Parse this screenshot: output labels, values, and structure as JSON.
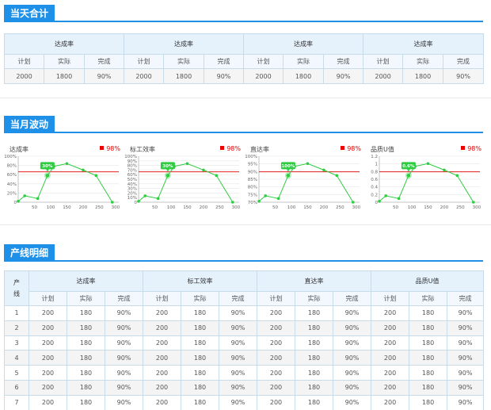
{
  "sections": {
    "summary_title": "当天合计",
    "fluctuation_title": "当月波动",
    "detail_title": "产线明细"
  },
  "metric_groups": [
    "达成率",
    "达成率",
    "达成率",
    "达成率"
  ],
  "sub_headers": [
    "计划",
    "实际",
    "完成"
  ],
  "summary_values": [
    [
      "2000",
      "1800",
      "90%"
    ],
    [
      "2000",
      "1800",
      "90%"
    ],
    [
      "2000",
      "1800",
      "90%"
    ],
    [
      "2000",
      "1800",
      "90%"
    ]
  ],
  "chart_data": [
    {
      "type": "line",
      "title": "达成率",
      "goal_label": "98%",
      "x": [
        0,
        20,
        60,
        90,
        110,
        150,
        200,
        240,
        290
      ],
      "y": [
        0.02,
        0.14,
        0.08,
        0.58,
        0.78,
        0.84,
        0.7,
        0.58,
        0.0
      ],
      "x_ticks": [
        "50",
        "100",
        "150",
        "200",
        "250",
        "300"
      ],
      "x_tick_values": [
        50,
        100,
        150,
        200,
        250,
        300
      ],
      "y_ticks": [
        "0",
        "20%",
        "40%",
        "60%",
        "80%",
        "100%"
      ],
      "y_tick_values": [
        0,
        0.2,
        0.4,
        0.6,
        0.8,
        1.0
      ],
      "ylim": [
        0,
        1.0
      ],
      "xlim": [
        0,
        310
      ],
      "goal_value": 0.66,
      "highlight_index": 3,
      "highlight_label": "30%",
      "line_color": "#2ecc40",
      "goal_color": "#e00000"
    },
    {
      "type": "line",
      "title": "标工效率",
      "goal_label": "98%",
      "x": [
        0,
        20,
        60,
        90,
        110,
        150,
        200,
        240,
        290
      ],
      "y": [
        0.02,
        0.14,
        0.08,
        0.58,
        0.78,
        0.84,
        0.7,
        0.58,
        0.0
      ],
      "x_ticks": [
        "50",
        "100",
        "150",
        "200",
        "250",
        "300"
      ],
      "x_tick_values": [
        50,
        100,
        150,
        200,
        250,
        300
      ],
      "y_ticks": [
        "0",
        "10%",
        "20%",
        "30%",
        "40%",
        "50%",
        "60%",
        "70%",
        "80%",
        "90%",
        "100%"
      ],
      "y_tick_values": [
        0,
        0.1,
        0.2,
        0.3,
        0.4,
        0.5,
        0.6,
        0.7,
        0.8,
        0.9,
        1.0
      ],
      "ylim": [
        0,
        1.0
      ],
      "xlim": [
        0,
        310
      ],
      "goal_value": 0.66,
      "highlight_index": 3,
      "highlight_label": "30%",
      "line_color": "#2ecc40",
      "goal_color": "#e00000"
    },
    {
      "type": "line",
      "title": "直达率",
      "goal_label": "98%",
      "x": [
        0,
        20,
        60,
        90,
        110,
        150,
        200,
        240,
        290
      ],
      "y": [
        0.02,
        0.14,
        0.08,
        0.58,
        0.78,
        0.84,
        0.7,
        0.58,
        0.0
      ],
      "x_ticks": [
        "50",
        "100",
        "150",
        "200",
        "250",
        "300"
      ],
      "x_tick_values": [
        50,
        100,
        150,
        200,
        250,
        300
      ],
      "y_ticks": [
        "70%",
        "75%",
        "80%",
        "85%",
        "90%",
        "95%",
        "100%"
      ],
      "y_tick_values": [
        0,
        0.1667,
        0.3333,
        0.5,
        0.6667,
        0.8333,
        1.0
      ],
      "ylim": [
        0,
        1.0
      ],
      "xlim": [
        0,
        310
      ],
      "goal_value": 0.66,
      "highlight_index": 3,
      "highlight_label": "100%",
      "line_color": "#2ecc40",
      "goal_color": "#e00000"
    },
    {
      "type": "line",
      "title": "品质U值",
      "goal_label": "98%",
      "x": [
        0,
        20,
        60,
        90,
        110,
        150,
        200,
        240,
        290
      ],
      "y": [
        0.02,
        0.14,
        0.08,
        0.58,
        0.78,
        0.84,
        0.7,
        0.58,
        0.0
      ],
      "x_ticks": [
        "50",
        "100",
        "150",
        "200",
        "250",
        "300"
      ],
      "x_tick_values": [
        50,
        100,
        150,
        200,
        250,
        300
      ],
      "y_ticks": [
        "0",
        "0.2",
        "0.4",
        "0.6",
        "0.8",
        "1",
        "1.2"
      ],
      "y_tick_values": [
        0,
        0.1667,
        0.3333,
        0.5,
        0.6667,
        0.8333,
        1.0
      ],
      "ylim": [
        0,
        1.0
      ],
      "xlim": [
        0,
        310
      ],
      "goal_value": 0.66,
      "highlight_index": 3,
      "highlight_label": "0.6%",
      "line_color": "#2ecc40",
      "goal_color": "#e00000"
    }
  ],
  "detail": {
    "row_header": "产线",
    "groups": [
      "达成率",
      "标工效率",
      "直达率",
      "品质U值"
    ],
    "rows": [
      {
        "no": "1",
        "cells": [
          "200",
          "180",
          "90%",
          "200",
          "180",
          "90%",
          "200",
          "180",
          "90%",
          "200",
          "180",
          "90%"
        ]
      },
      {
        "no": "2",
        "cells": [
          "200",
          "180",
          "90%",
          "200",
          "180",
          "90%",
          "200",
          "180",
          "90%",
          "200",
          "180",
          "90%"
        ]
      },
      {
        "no": "3",
        "cells": [
          "200",
          "180",
          "90%",
          "200",
          "180",
          "90%",
          "200",
          "180",
          "90%",
          "200",
          "180",
          "90%"
        ]
      },
      {
        "no": "4",
        "cells": [
          "200",
          "180",
          "90%",
          "200",
          "180",
          "90%",
          "200",
          "180",
          "90%",
          "200",
          "180",
          "90%"
        ]
      },
      {
        "no": "5",
        "cells": [
          "200",
          "180",
          "90%",
          "200",
          "180",
          "90%",
          "200",
          "180",
          "90%",
          "200",
          "180",
          "90%"
        ]
      },
      {
        "no": "6",
        "cells": [
          "200",
          "180",
          "90%",
          "200",
          "180",
          "90%",
          "200",
          "180",
          "90%",
          "200",
          "180",
          "90%"
        ]
      },
      {
        "no": "7",
        "cells": [
          "200",
          "180",
          "90%",
          "200",
          "180",
          "90%",
          "200",
          "180",
          "90%",
          "200",
          "180",
          "90%"
        ]
      }
    ]
  }
}
